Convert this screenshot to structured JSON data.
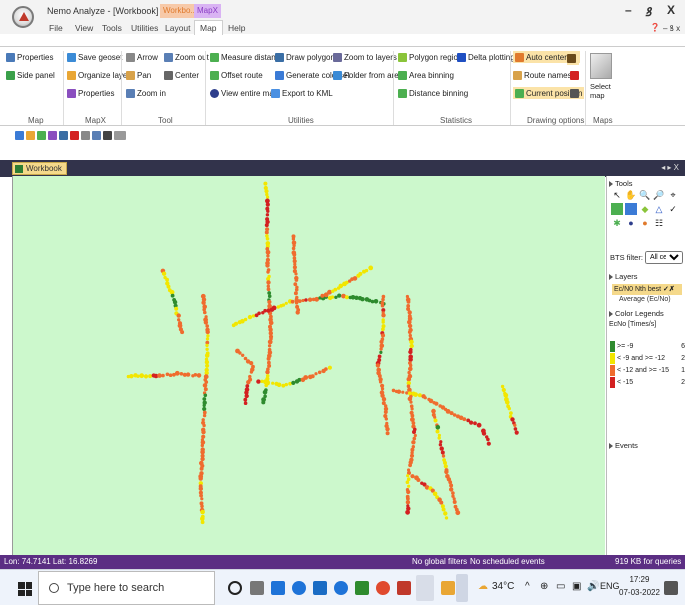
{
  "titlebar": {
    "title": "Nemo Analyze - [Workbook]",
    "context_tab_1": "Workbo...",
    "context_tab_2": "MapX",
    "minimize": "–",
    "restore": "ꝸ",
    "close": "X"
  },
  "menu": {
    "items": [
      "File",
      "View",
      "Tools",
      "Utilities",
      "Layout",
      "Map",
      "Help"
    ],
    "active": "Map",
    "sub_controls": "– ꝸ x"
  },
  "ribbon": {
    "map_group": {
      "properties": "Properties",
      "side_panel": "Side panel",
      "label": "Map"
    },
    "mapx_group": {
      "save_geoset": "Save geoset",
      "organize_layers": "Organize layers",
      "properties": "Properties",
      "label": "MapX"
    },
    "tool_group": {
      "arrow": "Arrow",
      "zoom_out": "Zoom out",
      "pan": "Pan",
      "center": "Center",
      "zoom_in": "Zoom in",
      "label": "Tool"
    },
    "utilities_group": {
      "measure_distance": "Measure distance",
      "draw_polygon": "Draw polygon",
      "zoom_to_layers": "Zoom to layers",
      "offset_route": "Offset route",
      "generate_colorset": "Generate colorset",
      "folder_from_area": "Folder from area",
      "view_entire_map": "View entire map",
      "export_to_kml": "Export to KML",
      "label": "Utilities"
    },
    "statistics_group": {
      "polygon_region": "Polygon region",
      "delta_plotting": "Delta plotting",
      "area_binning": "Area binning",
      "distance_binning": "Distance binning",
      "label": "Statistics"
    },
    "drawing_group": {
      "auto_centering": "Auto centering",
      "route_names": "Route names",
      "current_position": "Current position",
      "label": "Drawing options"
    },
    "maps_group": {
      "select_map": "Select map",
      "label": "Maps"
    }
  },
  "document": {
    "tab_label": "Workbook",
    "controls": "◂ ▸ X"
  },
  "side_panel": {
    "tools_header": "Tools",
    "bts_filter_label": "BTS filter:",
    "bts_filter_value": "All cells",
    "layers_header": "Layers",
    "layer_selected": "Ec/N0 Nth best",
    "layer_sub": "Average (Ec/No)",
    "legends_header": "Color Legends",
    "legend_title": "EcNo [Times/s]",
    "legend": [
      {
        "label": ">= -9",
        "count": "6",
        "color": "#2e8b2e"
      },
      {
        "label": "< -9 and >= -12",
        "count": "2",
        "color": "#f2e600"
      },
      {
        "label": "< -12 and >= -15",
        "count": "1",
        "color": "#ef6c2e"
      },
      {
        "label": "< -15",
        "count": "2",
        "color": "#d32020"
      }
    ],
    "events_header": "Events"
  },
  "status": {
    "coords": "Lon: 74.7141 Lat: 16.8269",
    "filters": "No global filters",
    "events": "No scheduled events",
    "queries": "919 KB for queries"
  },
  "taskbar": {
    "search_placeholder": "Type here to search",
    "temperature": "34°C",
    "language": "ENG",
    "time": "17:29",
    "date": "07-03-2022"
  },
  "map_colors": {
    "green": "#2e8b2e",
    "yellow": "#f2e600",
    "orange": "#ef6c2e",
    "red": "#d32020",
    "background": "#ccf8cc"
  }
}
